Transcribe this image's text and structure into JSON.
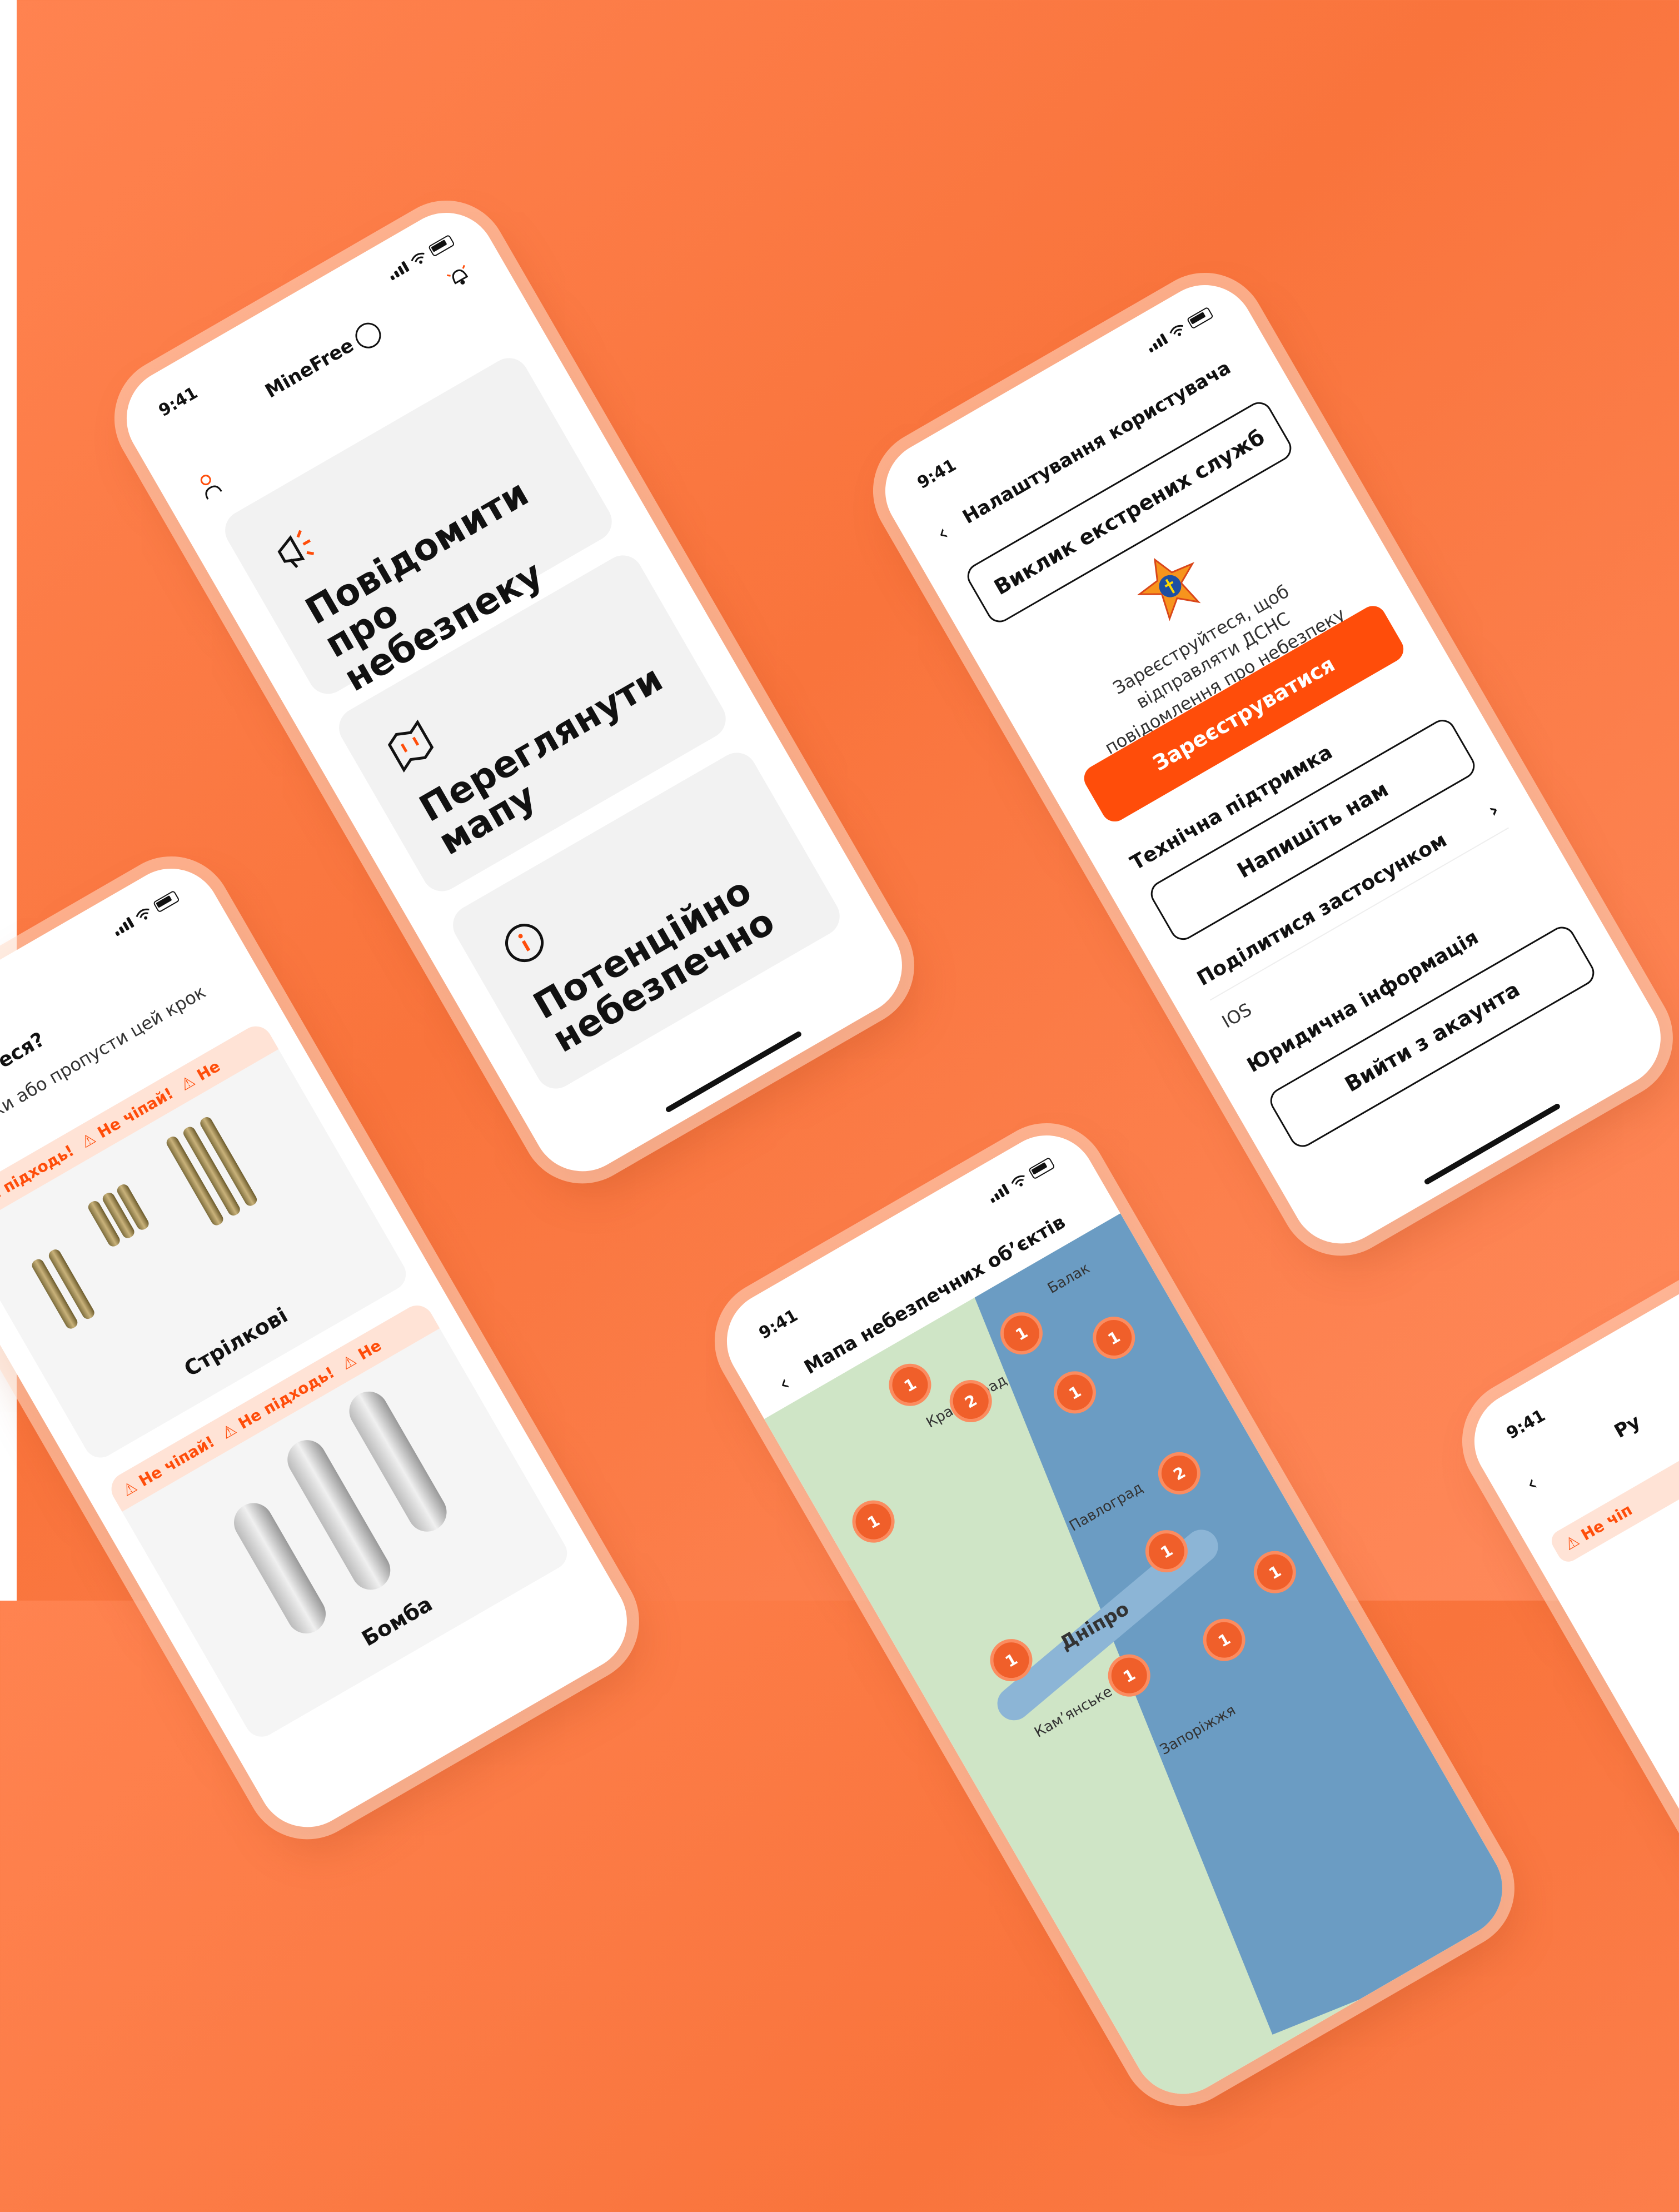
{
  "status": {
    "time": "9:41"
  },
  "main": {
    "app_name": "MineFree",
    "cards": [
      {
        "icon": "megaphone-icon",
        "title": "Повідомити про небезпеку"
      },
      {
        "icon": "map-icon",
        "title": "Переглянути мапу"
      },
      {
        "icon": "info-icon",
        "title": "Потенційно небезпечно"
      }
    ]
  },
  "settings": {
    "title": "Налаштування користувача",
    "emergency_button": "Виклик екстрених служб",
    "register_note": "Зареєструйтеся, щоб відправляти ДСНС повідомлення про небезпеку",
    "register_button": "Зареєструватися",
    "support_section": "Технічна підтримка",
    "write_us_button": "Напишіть нам",
    "share_row": "Поділитися застосунком",
    "platform": "IOS",
    "legal_section": "Юридична інформація",
    "logout_button": "Вийти з акаунта"
  },
  "map": {
    "title": "Мапа небезпечних об’єктів",
    "cities": [
      "Красноград",
      "Павлоград",
      "Дніпро",
      "Кам’янське",
      "Запоріжжя",
      "Балак"
    ],
    "clusters": [
      "1",
      "1",
      "2",
      "1",
      "1",
      "2",
      "1",
      "1",
      "1",
      "1",
      "1",
      "1"
    ]
  },
  "list": {
    "question": "знаходитеся?",
    "subtitle": "п знахідки або пропусти цей крок",
    "warnings": [
      "⚠ Не підходь!",
      "⚠ Не чіпай!",
      "⚠ Не"
    ],
    "items": [
      "Стрілкові",
      "Бомба"
    ]
  },
  "guide": {
    "title": "Ру",
    "warning": "⚠ Не чіп"
  },
  "colors": {
    "accent": "#ff4d0a",
    "background": "#f9743c"
  }
}
